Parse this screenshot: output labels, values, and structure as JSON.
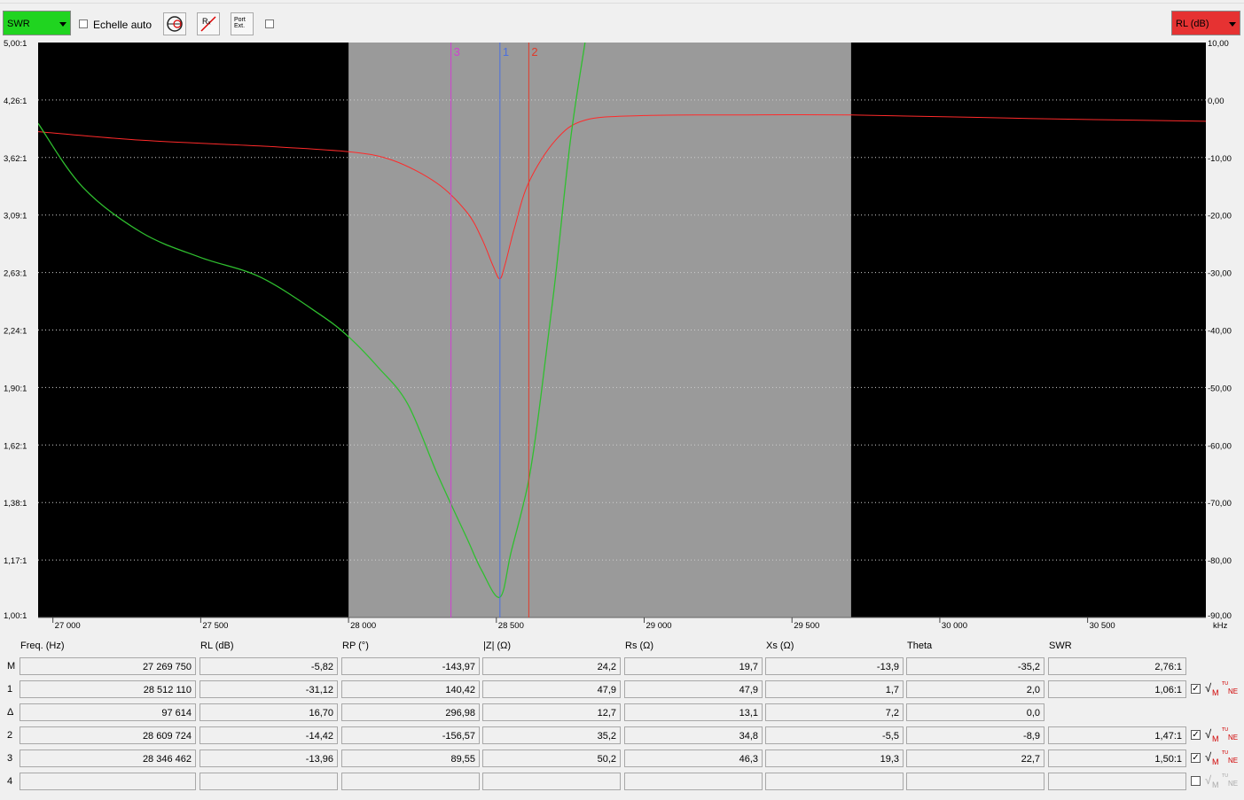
{
  "toolbar": {
    "left_dropdown": "SWR",
    "auto_scale_label": "Echelle auto",
    "button_rx": "Rₓ",
    "button_port_ext": "Port Ext.",
    "right_dropdown": "RL (dB)"
  },
  "colors": {
    "swr_curve": "#2fbf2f",
    "rl_curve": "#ff2a2a",
    "marker_1": "#4a6fe0",
    "marker_2": "#e03a2a",
    "marker_3": "#d040d0",
    "plot_bg": "#000000",
    "band_bg": "#9a9a9a"
  },
  "chart_data": {
    "type": "line",
    "x_unit": "kHz",
    "xlim": [
      26950,
      30900
    ],
    "x_ticks": [
      27000,
      27500,
      28000,
      28500,
      29000,
      29500,
      30000,
      30500
    ],
    "x_tick_labels": [
      "27 000",
      "27 500",
      "28 000",
      "28 500",
      "29 000",
      "29 500",
      "30 000",
      "30 500"
    ],
    "band": [
      28000,
      29700
    ],
    "left_axis": {
      "label": "SWR",
      "tick_labels": [
        "5,00:1",
        "4,26:1",
        "3,62:1",
        "3,09:1",
        "2,63:1",
        "2,24:1",
        "1,90:1",
        "1,62:1",
        "1,38:1",
        "1,17:1",
        "1,00:1"
      ],
      "scale": "return-loss spaced"
    },
    "right_axis": {
      "label": "RL (dB)",
      "ylim": [
        -90,
        10
      ],
      "tick_labels": [
        "10,00",
        "0,00",
        "-10,00",
        "-20,00",
        "-30,00",
        "-40,00",
        "-50,00",
        "-60,00",
        "-70,00",
        "-80,00",
        "-90,00"
      ]
    },
    "series": [
      {
        "name": "SWR",
        "color": "#2fbf2f",
        "x": [
          26950,
          27100,
          27300,
          27500,
          27700,
          27900,
          28000,
          28100,
          28200,
          28300,
          28400,
          28450,
          28512,
          28550,
          28609,
          28650,
          28700,
          28750,
          28800
        ],
        "y": [
          4.0,
          3.35,
          2.95,
          2.75,
          2.6,
          2.35,
          2.2,
          2.02,
          1.82,
          1.5,
          1.25,
          1.14,
          1.06,
          1.2,
          1.47,
          1.85,
          2.6,
          3.8,
          5.0
        ]
      },
      {
        "name": "RL (dB)",
        "color": "#ff2a2a",
        "x": [
          26950,
          27300,
          27700,
          28000,
          28150,
          28300,
          28400,
          28450,
          28490,
          28512,
          28530,
          28560,
          28609,
          28700,
          28800,
          29000,
          29300,
          29700,
          30300,
          30900
        ],
        "y": [
          -5.5,
          -7.0,
          -8.0,
          -9.0,
          -10.5,
          -14.5,
          -19.5,
          -24.0,
          -29.0,
          -31.1,
          -28.5,
          -22.5,
          -14.4,
          -7.0,
          -3.5,
          -2.7,
          -2.6,
          -2.6,
          -3.2,
          -3.7
        ]
      }
    ],
    "markers": [
      {
        "id": "1",
        "freq_khz": 28512.11
      },
      {
        "id": "2",
        "freq_khz": 28609.724
      },
      {
        "id": "3",
        "freq_khz": 28346.462
      }
    ]
  },
  "table": {
    "headers": [
      "Freq. (Hz)",
      "RL (dB)",
      "RP (°)",
      "|Z| (Ω)",
      "Rs (Ω)",
      "Xs (Ω)",
      "Theta",
      "SWR"
    ],
    "rows": [
      {
        "label": "M",
        "values": [
          "27 269 750",
          "-5,82",
          "-143,97",
          "24,2",
          "19,7",
          "-13,9",
          "-35,2",
          "2,76:1"
        ],
        "checkbox": "none"
      },
      {
        "label": "1",
        "values": [
          "28 512 110",
          "-31,12",
          "140,42",
          "47,9",
          "47,9",
          "1,7",
          "2,0",
          "1,06:1"
        ],
        "checkbox": "checked"
      },
      {
        "label": "Δ",
        "values": [
          "97 614",
          "16,70",
          "296,98",
          "12,7",
          "13,1",
          "7,2",
          "0,0",
          ""
        ],
        "checkbox": "none"
      },
      {
        "label": "2",
        "values": [
          "28 609 724",
          "-14,42",
          "-156,57",
          "35,2",
          "34,8",
          "-5,5",
          "-8,9",
          "1,47:1"
        ],
        "checkbox": "checked"
      },
      {
        "label": "3",
        "values": [
          "28 346 462",
          "-13,96",
          "89,55",
          "50,2",
          "46,3",
          "19,3",
          "22,7",
          "1,50:1"
        ],
        "checkbox": "checked"
      },
      {
        "label": "4",
        "values": [
          "",
          "",
          "",
          "",
          "",
          "",
          "",
          ""
        ],
        "checkbox": "unchecked"
      }
    ],
    "icon_m": "M",
    "icon_ne": "NE"
  }
}
